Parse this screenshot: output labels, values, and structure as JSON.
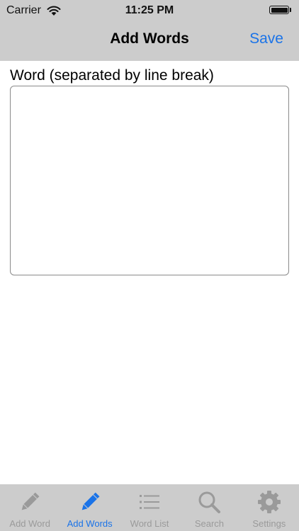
{
  "status_bar": {
    "carrier": "Carrier",
    "time": "11:25 PM",
    "wifi_icon": "wifi-icon",
    "battery_icon": "battery-icon"
  },
  "nav": {
    "title": "Add Words",
    "save_label": "Save"
  },
  "form": {
    "label": "Word (separated by line break)",
    "value": ""
  },
  "tabs": [
    {
      "label": "Add Word",
      "icon": "pencil-icon",
      "active": false
    },
    {
      "label": "Add Words",
      "icon": "pencil-icon",
      "active": true
    },
    {
      "label": "Word List",
      "icon": "list-icon",
      "active": false
    },
    {
      "label": "Search",
      "icon": "search-icon",
      "active": false
    },
    {
      "label": "Settings",
      "icon": "gear-icon",
      "active": false
    }
  ],
  "colors": {
    "accent": "#1a73e8",
    "inactive": "#9a9a9a",
    "bar_background": "#cccccc"
  }
}
